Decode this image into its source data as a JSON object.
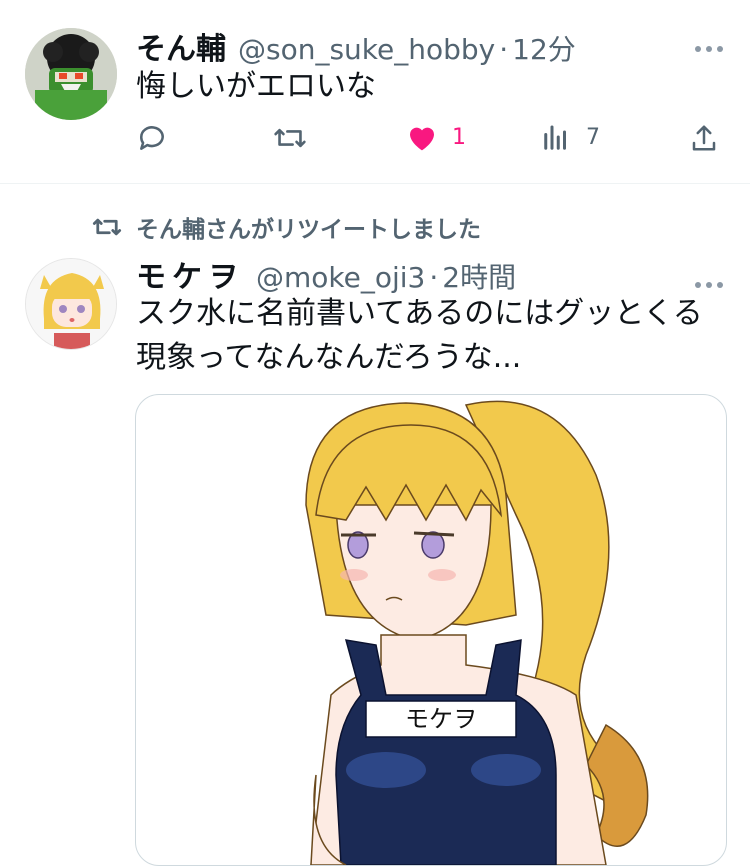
{
  "tweet1": {
    "name": "そん輔",
    "handle": "@son_suke_hobby",
    "separator": "·",
    "time": "12分",
    "text": "悔しいがエロいな",
    "actions": {
      "reply_count": "",
      "retweet_count": "",
      "like_count": "1",
      "views_count": "7"
    },
    "liked": true
  },
  "retweet_label": "そん輔さんがリツイートしました",
  "tweet2": {
    "name": "モケヲ",
    "handle": "@moke_oji3",
    "separator": "·",
    "time": "2時間",
    "text_line1": "スク水に名前書いてあるのにはグッとくる",
    "text_line2": "現象ってなんなんだろうな...",
    "image_name_tag": "モケヲ"
  },
  "colors": {
    "like": "#f91880",
    "secondary_text": "#536471",
    "primary_text": "#0f1419"
  }
}
